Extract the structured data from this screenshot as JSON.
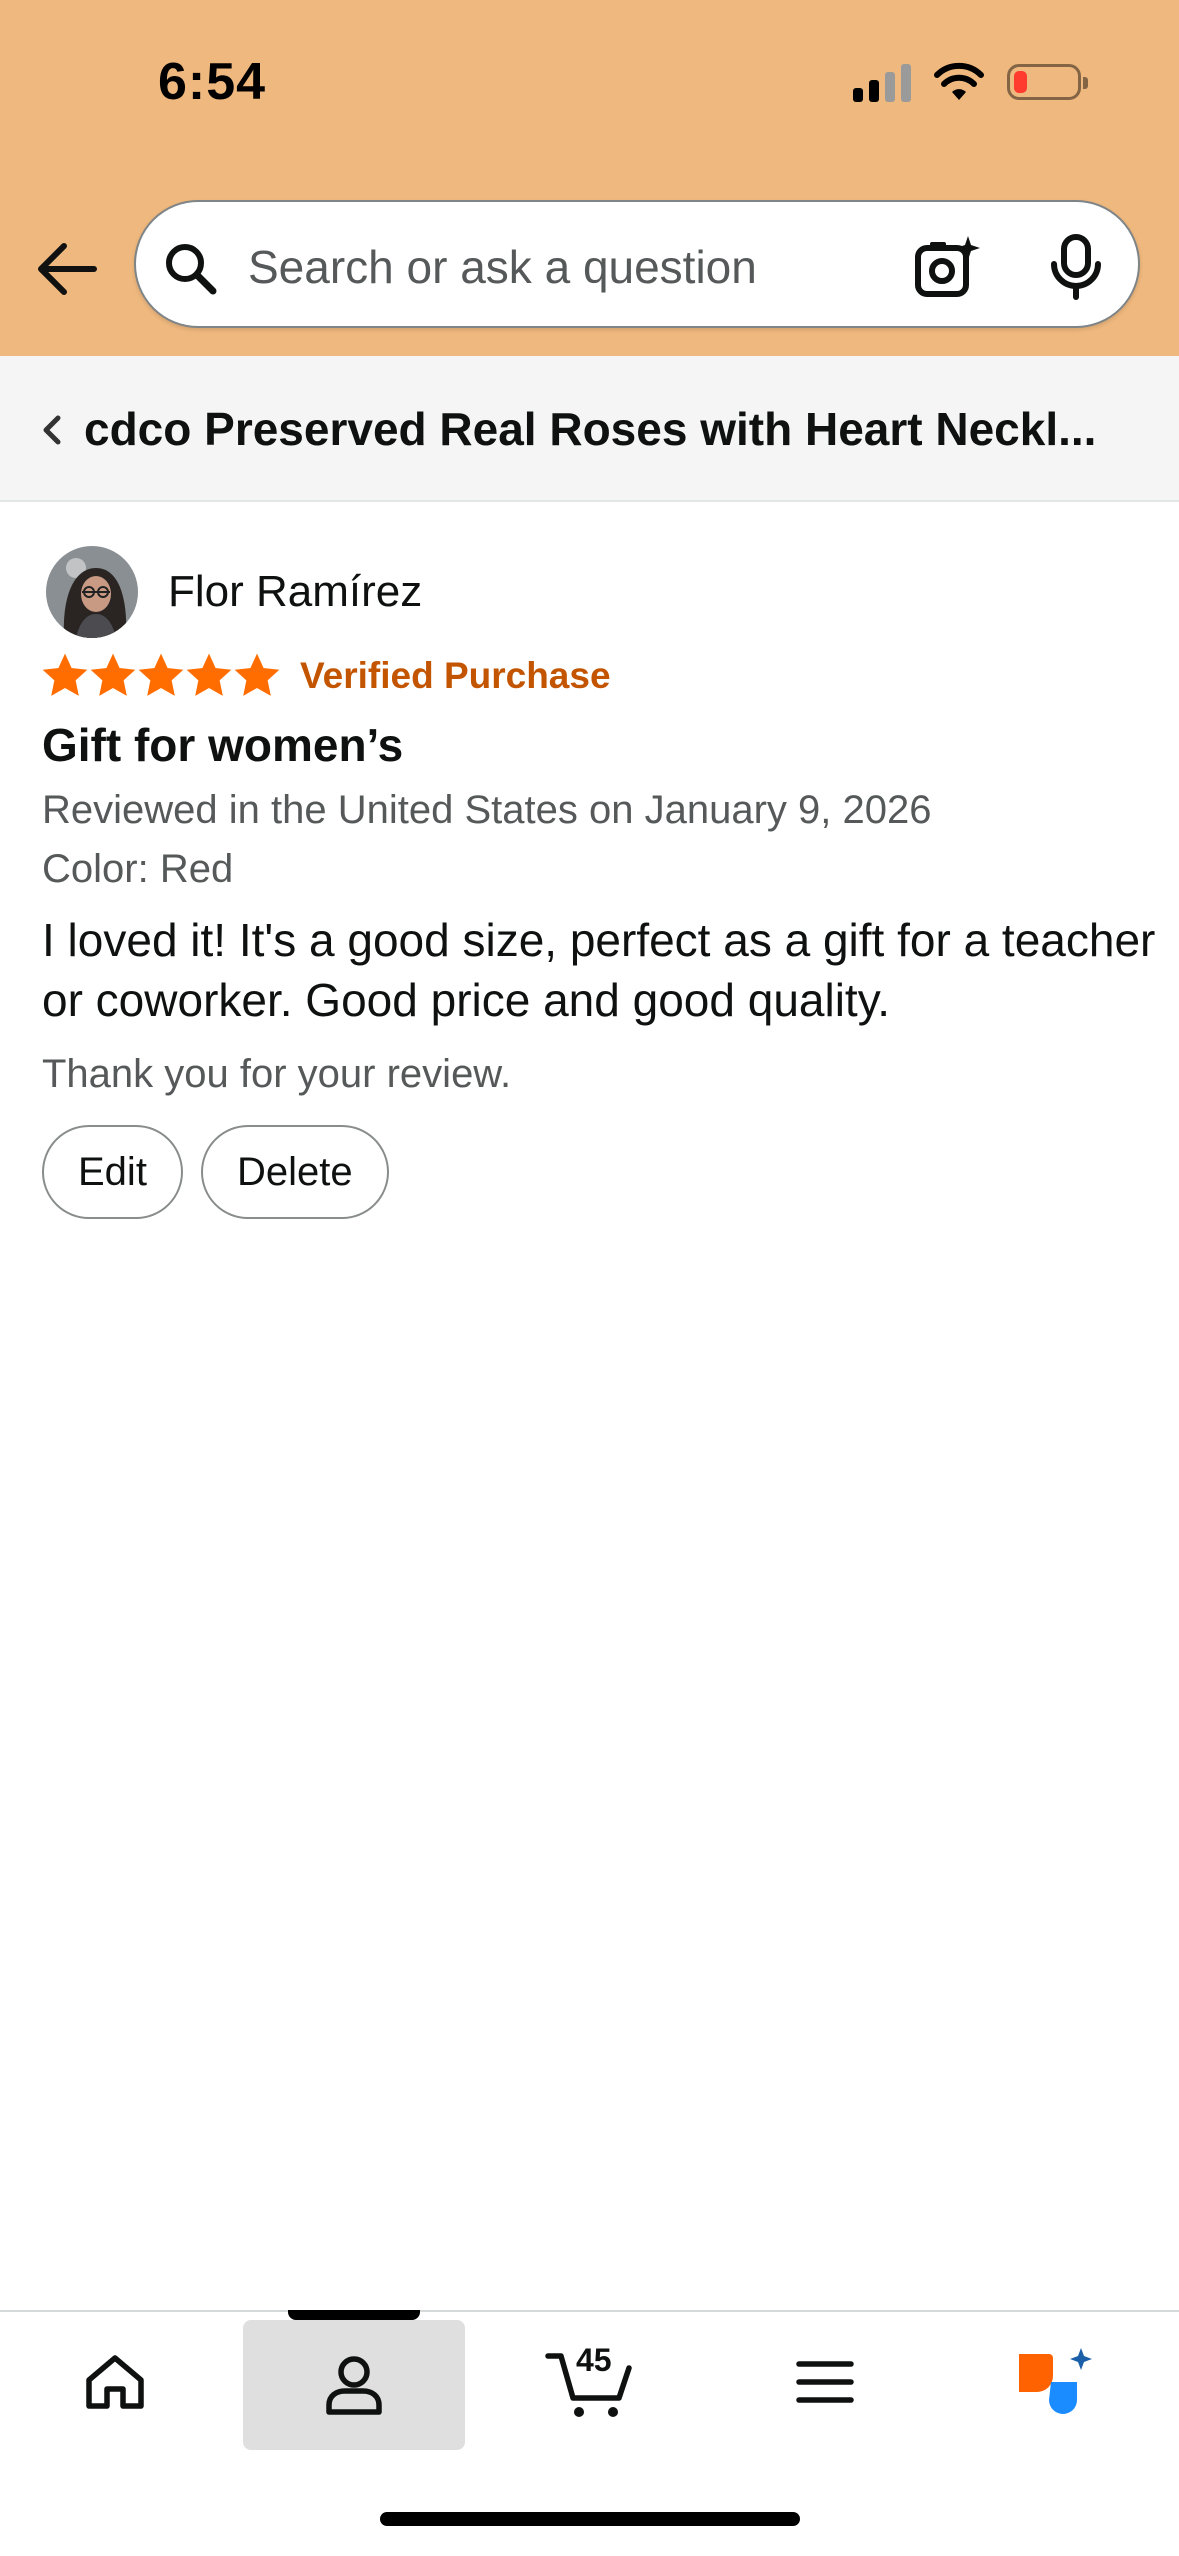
{
  "status_bar": {
    "time": "6:54"
  },
  "search": {
    "placeholder": "Search or ask a question"
  },
  "product": {
    "title": "cdco Preserved Real Roses with Heart Neckl..."
  },
  "review": {
    "reviewer_name": "Flor Ramírez",
    "rating": 5,
    "rating_max": 5,
    "verified_label": "Verified Purchase",
    "title": "Gift for women’s",
    "meta": "Reviewed in the United States on January 9, 2026",
    "color": "Color: Red",
    "body": "I loved it! It's a good size, perfect as a gift for a teacher or coworker. Good price and good quality.",
    "thanks": "Thank you for your review.",
    "edit_label": "Edit",
    "delete_label": "Delete"
  },
  "tabbar": {
    "cart_count": "45",
    "active_tab": "you",
    "tabs": [
      {
        "id": "home",
        "icon": "home-icon"
      },
      {
        "id": "you",
        "icon": "person-icon"
      },
      {
        "id": "cart",
        "icon": "cart-icon"
      },
      {
        "id": "menu",
        "icon": "menu-icon"
      },
      {
        "id": "rufus",
        "icon": "rufus-icon"
      }
    ]
  },
  "colors": {
    "header_bg": "#efb87e",
    "star": "#ff6d00",
    "verified": "#c45500",
    "secondary_text": "#565959",
    "battery_low": "#ff3b30"
  }
}
